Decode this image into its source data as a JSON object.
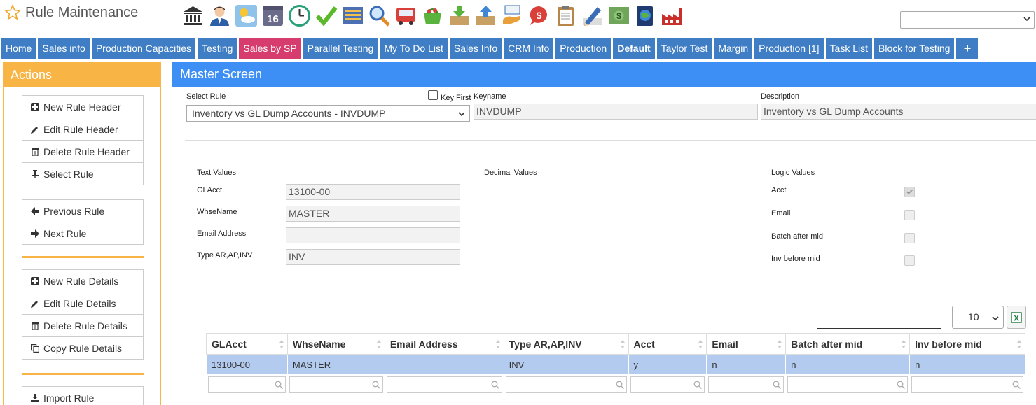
{
  "app": {
    "title": "Rule Maintenance"
  },
  "toolbar_icons": [
    "bank-icon",
    "user-icon",
    "weather-icon",
    "calendar-16-icon",
    "clock-icon",
    "checkmark-icon",
    "list-icon",
    "magnifier-icon",
    "truck-icon",
    "basket-icon",
    "inbox-download-icon",
    "inbox-upload-icon",
    "hand-money-icon",
    "dollar-bubble-icon",
    "clipboard-icon",
    "pencil-icon",
    "cash-icon",
    "globe-book-icon",
    "factory-icon"
  ],
  "calendar_day": "16",
  "nav": {
    "tabs": [
      {
        "label": "Home"
      },
      {
        "label": "Sales info"
      },
      {
        "label": "Production Capacities"
      },
      {
        "label": "Testing"
      },
      {
        "label": "Sales by SP"
      },
      {
        "label": "Parallel Testing"
      },
      {
        "label": "My To Do List"
      },
      {
        "label": "Sales Info"
      },
      {
        "label": "CRM Info"
      },
      {
        "label": "Production"
      },
      {
        "label": "Default"
      },
      {
        "label": "Taylor Test"
      },
      {
        "label": "Margin"
      },
      {
        "label": "Production [1]"
      },
      {
        "label": "Task List"
      },
      {
        "label": "Block for Testing"
      }
    ],
    "plus": "+"
  },
  "actions": {
    "title": "Actions",
    "header_group": [
      "New Rule Header",
      "Edit Rule Header",
      "Delete Rule Header",
      "Select Rule"
    ],
    "nav_group": [
      "Previous Rule",
      "Next Rule"
    ],
    "details_group": [
      "New Rule Details",
      "Edit Rule Details",
      "Delete Rule Details",
      "Copy Rule Details"
    ],
    "import_group": [
      "Import Rule"
    ]
  },
  "master": {
    "title": "Master Screen",
    "select_rule_label": "Select Rule",
    "select_rule_value": "Inventory vs GL Dump Accounts - INVDUMP",
    "key_first_label": "Key First",
    "keyname_label": "Keyname",
    "keyname_value": "INVDUMP",
    "description_label": "Description",
    "description_value": "Inventory vs GL Dump Accounts",
    "text_values_label": "Text Values",
    "decimal_values_label": "Decimal Values",
    "logic_values_label": "Logic Values",
    "text_fields": [
      {
        "label": "GLAcct",
        "value": "13100-00"
      },
      {
        "label": "WhseName",
        "value": "MASTER"
      },
      {
        "label": "Email Address",
        "value": ""
      },
      {
        "label": "Type AR,AP,INV",
        "value": "INV"
      }
    ],
    "logic_fields": [
      {
        "label": "Acct",
        "checked": true
      },
      {
        "label": "Email",
        "checked": false
      },
      {
        "label": "Batch after mid",
        "checked": false
      },
      {
        "label": "Inv before mid",
        "checked": false
      }
    ]
  },
  "grid": {
    "page_size": "10",
    "columns": [
      "GLAcct",
      "WhseName",
      "Email Address",
      "Type AR,AP,INV",
      "Acct",
      "Email",
      "Batch after mid",
      "Inv before mid"
    ],
    "rows": [
      [
        "13100-00",
        "MASTER",
        "",
        "INV",
        "y",
        "n",
        "n",
        "n"
      ]
    ]
  }
}
